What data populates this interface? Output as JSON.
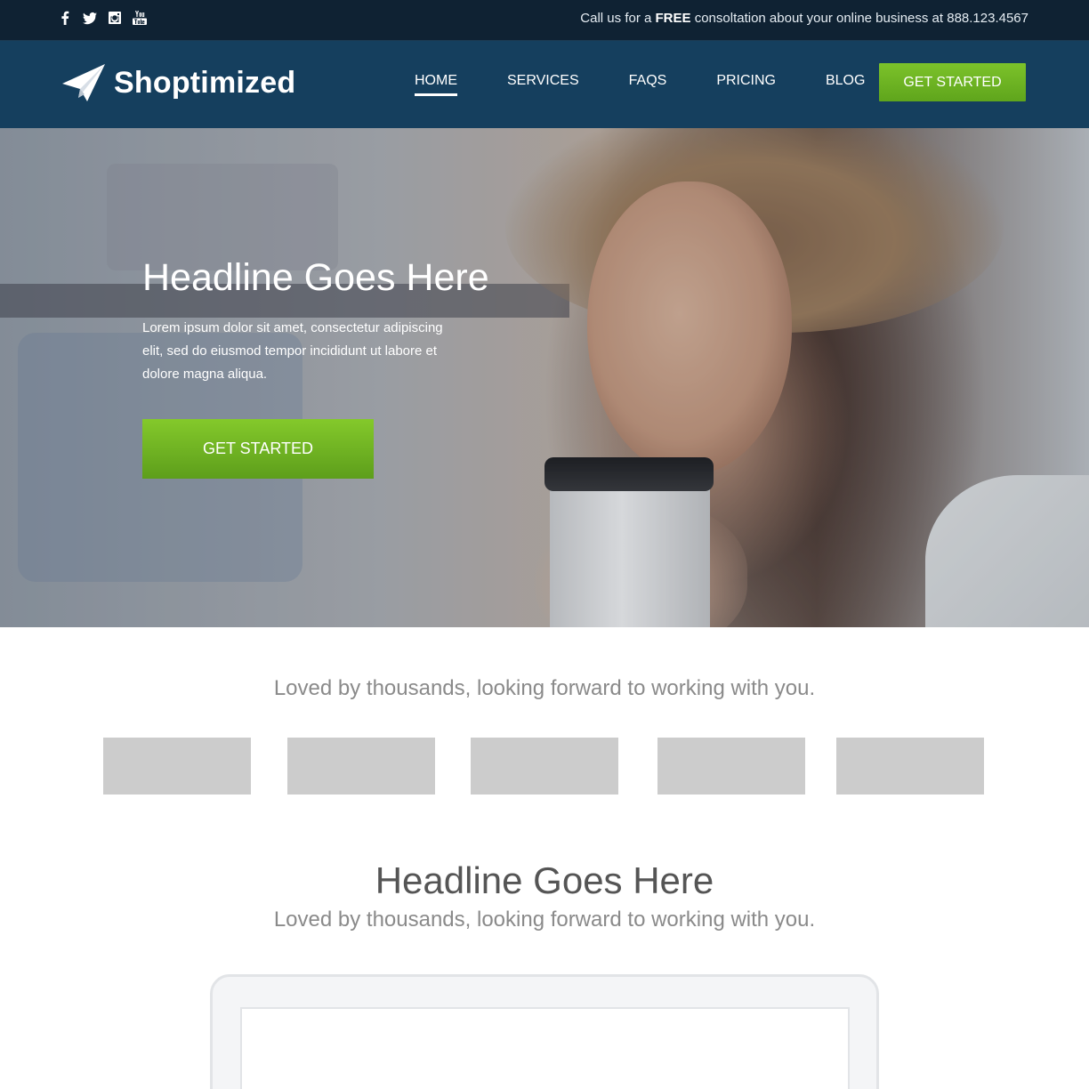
{
  "topbar": {
    "social_icons": [
      "facebook-icon",
      "twitter-icon",
      "instagram-icon",
      "youtube-icon"
    ],
    "call_prefix": "Call us for a",
    "call_free": "FREE",
    "call_suffix": "consoltation about your online business at",
    "phone": "888.123.4567"
  },
  "header": {
    "logo_text": "Shoptimized",
    "nav": [
      "HOME",
      "SERVICES",
      "FAQS",
      "PRICING",
      "BLOG"
    ],
    "active_nav": "HOME",
    "cta_label": "GET STARTED"
  },
  "hero": {
    "title": "Headline Goes Here",
    "text": "Lorem ipsum dolor sit amet, consectetur adipiscing elit, sed do eiusmod tempor incididunt ut labore et dolore magna aliqua.",
    "cta_label": "GET STARTED"
  },
  "testimonials": {
    "tagline": "Loved by thousands, looking forward to working with you.",
    "logo_placeholder_count": 5
  },
  "section2": {
    "title": "Headline Goes Here",
    "subtitle": "Loved by thousands, looking forward to working with you."
  },
  "colors": {
    "topbar_bg": "#0f2233",
    "navbar_bg": "#153f5e",
    "cta_green": "#6cb322",
    "placeholder_gray": "#cccccc"
  }
}
